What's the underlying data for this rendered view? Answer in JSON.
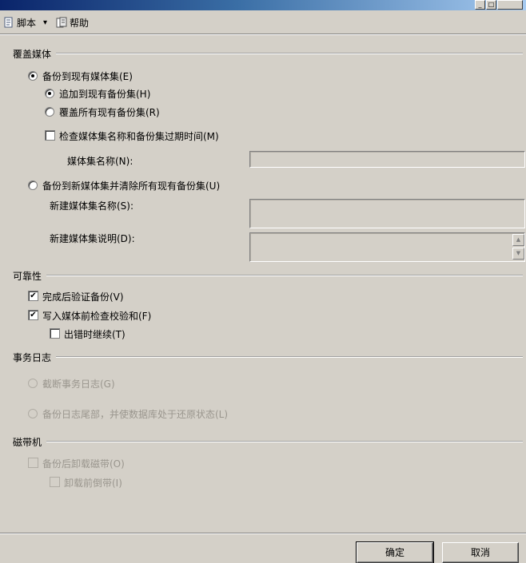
{
  "toolbar": {
    "script_label": "脚本",
    "script_arrow": "▾",
    "help_label": "帮助"
  },
  "overwrite": {
    "section_title": "覆盖媒体",
    "backup_existing": "备份到现有媒体集(E)",
    "append": "追加到现有备份集(H)",
    "overwrite_all": "覆盖所有现有备份集(R)",
    "check_name_expiry": "检查媒体集名称和备份集过期时间(M)",
    "media_set_name_label": "媒体集名称(N):",
    "backup_new": "备份到新媒体集并清除所有现有备份集(U)",
    "new_media_set_name_label": "新建媒体集名称(S):",
    "new_media_set_desc_label": "新建媒体集说明(D):"
  },
  "reliability": {
    "section_title": "可靠性",
    "verify": "完成后验证备份(V)",
    "checksum": "写入媒体前检查校验和(F)",
    "continue_on_error": "出错时继续(T)"
  },
  "txlog": {
    "section_title": "事务日志",
    "truncate": "截断事务日志(G)",
    "tail": "备份日志尾部，并使数据库处于还原状态(L)"
  },
  "tape": {
    "section_title": "磁带机",
    "unload": "备份后卸载磁带(O)",
    "rewind": "卸载前倒带(I)"
  },
  "buttons": {
    "ok": "确定",
    "cancel": "取消"
  },
  "colors": {
    "dialog_bg": "#d4d0c8",
    "disabled_text": "#9a968e",
    "title_gradient_start": "#0a246a"
  }
}
